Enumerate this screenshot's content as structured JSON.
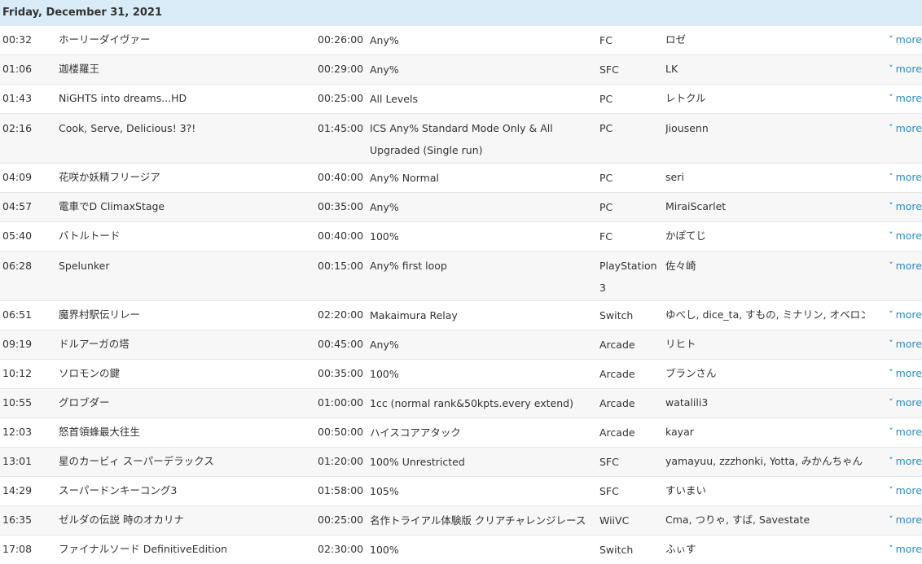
{
  "day_header": "Friday, December 31, 2021",
  "more_label": "more",
  "rows": [
    {
      "time": "00:32",
      "game": "ホーリーダイヴァー",
      "estimate": "00:26:00",
      "category": "Any%",
      "platform": "FC",
      "runner": "ロゼ"
    },
    {
      "time": "01:06",
      "game": "迦楼羅王",
      "estimate": "00:29:00",
      "category": "Any%",
      "platform": "SFC",
      "runner": "LK"
    },
    {
      "time": "01:43",
      "game": "NiGHTS into dreams...HD",
      "estimate": "00:25:00",
      "category": "All Levels",
      "platform": "PC",
      "runner": "レトクル"
    },
    {
      "time": "02:16",
      "game": "Cook, Serve, Delicious! 3?!",
      "estimate": "01:45:00",
      "category": "ICS Any% Standard Mode Only & All Upgraded (Single run)",
      "platform": "PC",
      "runner": "Jiousenn"
    },
    {
      "time": "04:09",
      "game": "花咲か妖精フリージア",
      "estimate": "00:40:00",
      "category": "Any% Normal",
      "platform": "PC",
      "runner": "seri"
    },
    {
      "time": "04:57",
      "game": "電車でD ClimaxStage",
      "estimate": "00:35:00",
      "category": "Any%",
      "platform": "PC",
      "runner": "MiraiScarlet"
    },
    {
      "time": "05:40",
      "game": "バトルトード",
      "estimate": "00:40:00",
      "category": "100%",
      "platform": "FC",
      "runner": "かぽてじ"
    },
    {
      "time": "06:28",
      "game": "Spelunker",
      "estimate": "00:15:00",
      "category": "Any% first loop",
      "platform": "PlayStation 3",
      "runner": "佐々崎"
    },
    {
      "time": "06:51",
      "game": "魔界村駅伝リレー",
      "estimate": "02:20:00",
      "category": "Makaimura Relay",
      "platform": "Switch",
      "runner": "ゆべし, dice_ta, すもの, ミナリン, オベロン"
    },
    {
      "time": "09:19",
      "game": "ドルアーガの塔",
      "estimate": "00:45:00",
      "category": "Any%",
      "platform": "Arcade",
      "runner": "リヒト"
    },
    {
      "time": "10:12",
      "game": "ソロモンの鍵",
      "estimate": "00:35:00",
      "category": "100%",
      "platform": "Arcade",
      "runner": "ブランさん"
    },
    {
      "time": "10:55",
      "game": "グロブダー",
      "estimate": "01:00:00",
      "category": "1cc (normal rank&50kpts.every extend)",
      "platform": "Arcade",
      "runner": "watalili3"
    },
    {
      "time": "12:03",
      "game": "怒首領蜂最大往生",
      "estimate": "00:50:00",
      "category": "ハイスコアアタック",
      "platform": "Arcade",
      "runner": "kayar"
    },
    {
      "time": "13:01",
      "game": "星のカービィ スーパーデラックス",
      "estimate": "01:20:00",
      "category": "100% Unrestricted",
      "platform": "SFC",
      "runner": "yamayuu, zzzhonki, Yotta, みかんちゃん"
    },
    {
      "time": "14:29",
      "game": "スーパードンキーコング3",
      "estimate": "01:58:00",
      "category": "105%",
      "platform": "SFC",
      "runner": "すいまい"
    },
    {
      "time": "16:35",
      "game": "ゼルダの伝説 時のオカリナ",
      "estimate": "00:25:00",
      "category": "名作トライアル体験版 クリアチャレンジレース",
      "platform": "WiiVC",
      "runner": "Cma, つりゃ, すば, Savestate"
    },
    {
      "time": "17:08",
      "game": "ファイナルソード DefinitiveEdition",
      "estimate": "02:30:00",
      "category": "100%",
      "platform": "Switch",
      "runner": "ふぃす"
    }
  ]
}
